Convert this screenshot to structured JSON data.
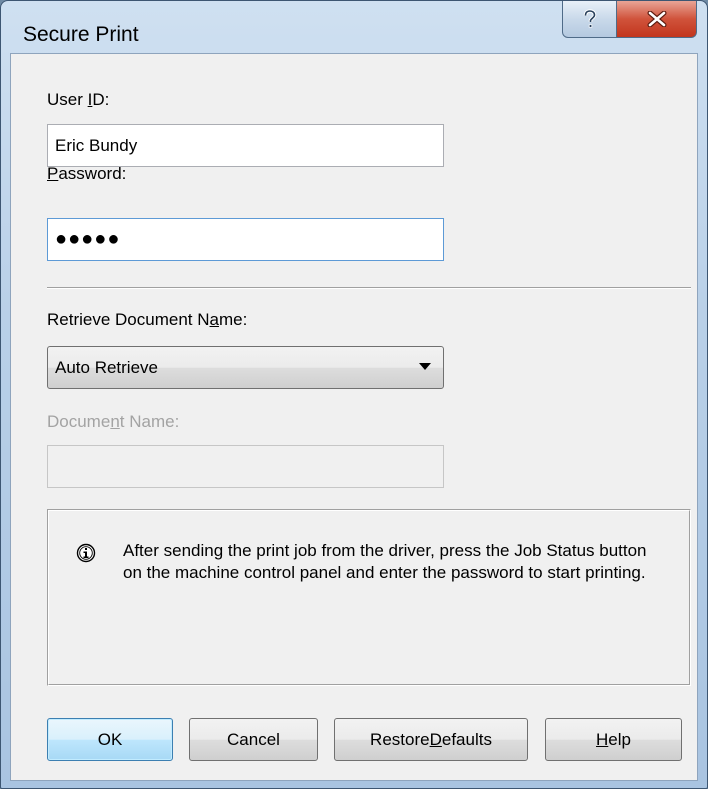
{
  "window": {
    "title": "Secure Print",
    "help_glyph": "?",
    "close_glyph": "x"
  },
  "user_id": {
    "label_pre": "User ",
    "label_ul": "I",
    "label_post": "D:",
    "value": "Eric Bundy"
  },
  "password": {
    "label_pre": "",
    "label_ul": "P",
    "label_post": "assword:",
    "masked_value": "●●●●●"
  },
  "retrieve": {
    "label_pre": "Retrieve Document N",
    "label_ul": "a",
    "label_post": "me:",
    "selected": "Auto Retrieve"
  },
  "document_name": {
    "label_pre": "Docume",
    "label_ul": "n",
    "label_post": "t Name:",
    "value": ""
  },
  "info": {
    "icon": "info-icon",
    "text": "After sending the print job from the driver, press the Job Status button on the machine control panel and enter the password to start printing."
  },
  "buttons": {
    "ok": "OK",
    "cancel": "Cancel",
    "restore_pre": "Restore ",
    "restore_ul": "D",
    "restore_post": "efaults",
    "help_ul": "H",
    "help_post": "elp"
  },
  "colors": {
    "title_bar": "#b9d0e8",
    "close_button": "#c2351d",
    "default_button": "#bee6fd"
  }
}
